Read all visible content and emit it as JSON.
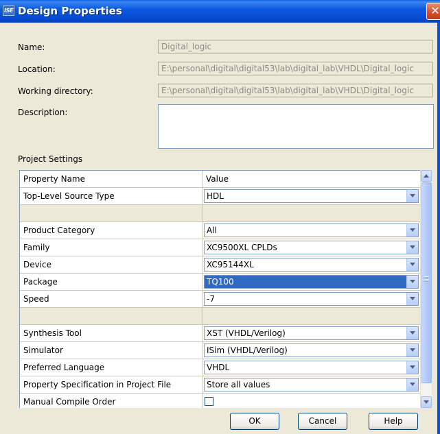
{
  "window": {
    "icon_text": "ISE",
    "title": "Design Properties",
    "close_glyph": "✕"
  },
  "fields": {
    "name_label": "Name:",
    "name_value": "Digital_logic",
    "location_label": "Location:",
    "location_value": "E:\\personal\\digital\\digital53\\lab\\digital_lab\\VHDL\\Digital_logic",
    "workdir_label": "Working directory:",
    "workdir_value": "E:\\personal\\digital\\digital53\\lab\\digital_lab\\VHDL\\Digital_logic",
    "description_label": "Description:",
    "description_value": ""
  },
  "settings": {
    "section_label": "Project Settings",
    "header_name": "Property Name",
    "header_value": "Value",
    "rows": [
      {
        "name": "Top-Level Source Type",
        "value": "HDL"
      },
      {
        "name": "Product Category",
        "value": "All"
      },
      {
        "name": "Family",
        "value": "XC9500XL CPLDs"
      },
      {
        "name": "Device",
        "value": "XC95144XL"
      },
      {
        "name": "Package",
        "value": "TQ100",
        "selected": true
      },
      {
        "name": "Speed",
        "value": "-7"
      },
      {
        "name": "Synthesis Tool",
        "value": "XST (VHDL/Verilog)"
      },
      {
        "name": "Simulator",
        "value": "ISim (VHDL/Verilog)"
      },
      {
        "name": "Preferred Language",
        "value": "VHDL"
      },
      {
        "name": "Property Specification in Project File",
        "value": "Store all values"
      },
      {
        "name": "Manual Compile Order",
        "value": "",
        "type": "checkbox",
        "checked": false
      }
    ]
  },
  "buttons": {
    "ok": "OK",
    "cancel": "Cancel",
    "help": "Help"
  },
  "colors": {
    "titlebar": "#0b5ae0",
    "selection": "#316ac5",
    "dialog_bg": "#ece9d8"
  },
  "icons": [
    "ise-app-icon",
    "close-icon",
    "dropdown-arrow-icon",
    "scroll-up-icon",
    "scroll-down-icon"
  ]
}
